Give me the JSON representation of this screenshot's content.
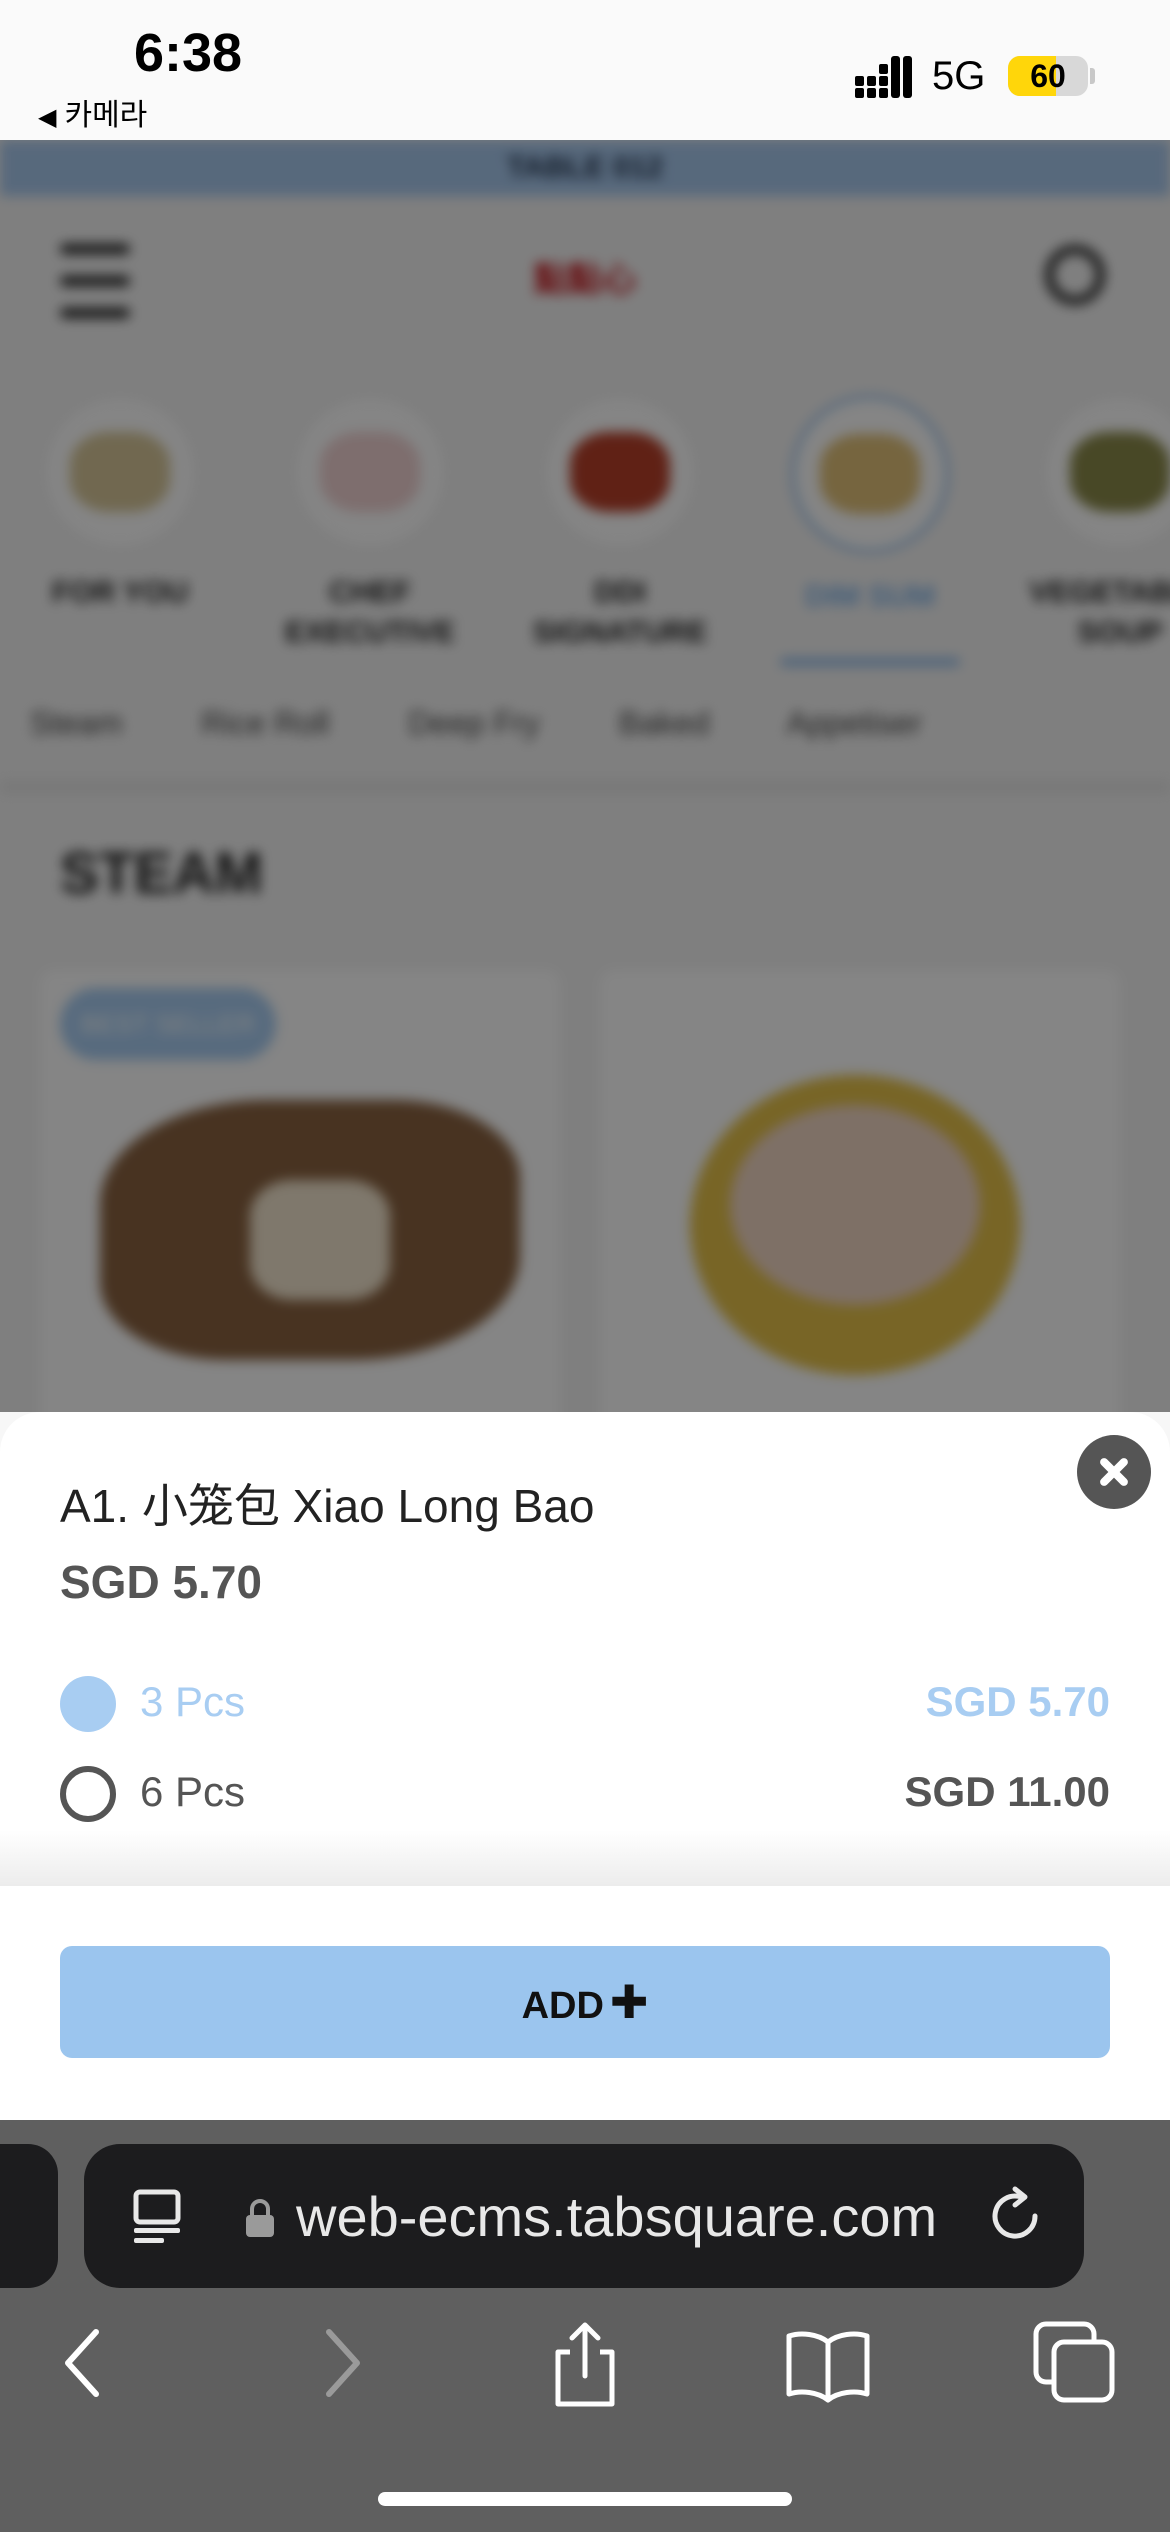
{
  "status_bar": {
    "time": "6:38",
    "back_app": "카메라",
    "network": "5G",
    "battery": "60"
  },
  "background_page": {
    "table_banner": "TABLE 012",
    "logo": "點點心",
    "categories": [
      {
        "label": "FOR YOU"
      },
      {
        "label": "CHEF EXECUTIVE"
      },
      {
        "label": "DDI SIGNATURE"
      },
      {
        "label": "DIM SUM",
        "active": true
      },
      {
        "label": "VEGETABLE SOUP"
      }
    ],
    "subtabs": [
      "Steam",
      "Rice Roll",
      "Deep Fry",
      "Baked",
      "Appetiser"
    ],
    "section_title": "STEAM",
    "badge": "BEST SELLER"
  },
  "item_sheet": {
    "title": "A1. 小笼包 Xiao Long Bao",
    "price": "SGD 5.70",
    "options": [
      {
        "label": "3 Pcs",
        "price": "SGD 5.70",
        "selected": true
      },
      {
        "label": "6 Pcs",
        "price": "SGD 11.00",
        "selected": false
      }
    ],
    "add_label": "ADD",
    "add_icon": "plus-icon"
  },
  "browser": {
    "url": "web-ecms.tabsquare.com",
    "icons": [
      "reader-icon",
      "lock-icon",
      "reload-icon",
      "back-icon",
      "forward-icon",
      "share-icon",
      "bookmarks-icon",
      "tabs-icon"
    ]
  },
  "colors": {
    "accent_light_blue": "#9bc5ee",
    "selected_option": "#a8cdf2",
    "text_dark": "#222222",
    "toolbar_bg": "#5f5f5f"
  }
}
